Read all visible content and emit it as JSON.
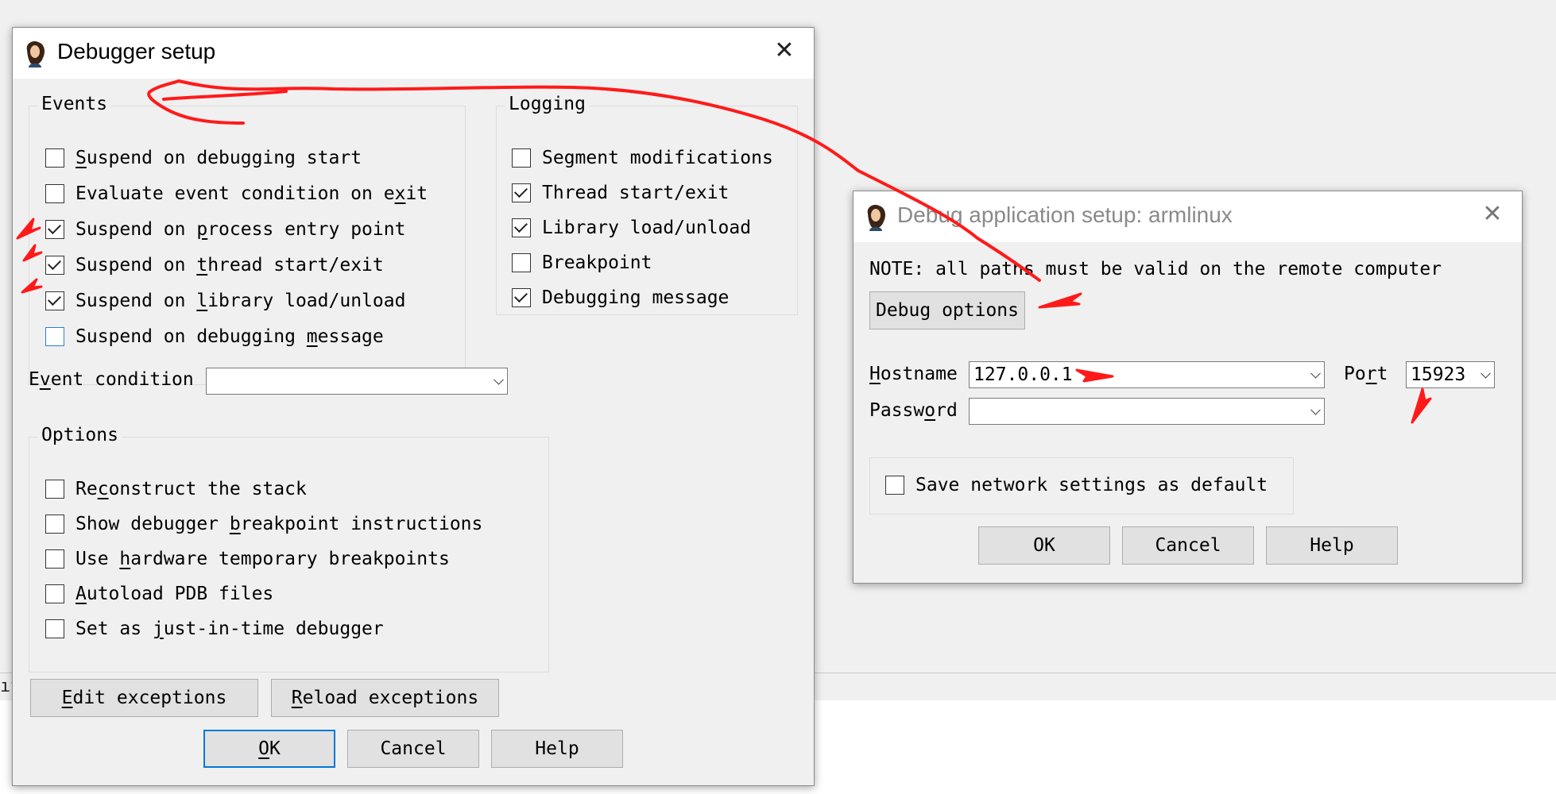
{
  "background": {
    "fragment_text": "ıt"
  },
  "debugger_setup": {
    "title": "Debugger setup",
    "close_glyph": "✕",
    "events": {
      "label": "Events",
      "items": [
        {
          "pre": "",
          "u": "S",
          "post": "uspend on debugging start",
          "checked": false
        },
        {
          "pre": "Evaluate event condition on e",
          "u": "x",
          "post": "it",
          "checked": false
        },
        {
          "pre": "Suspend on ",
          "u": "p",
          "post": "rocess entry point",
          "checked": true
        },
        {
          "pre": "Suspend on ",
          "u": "t",
          "post": "hread start/exit",
          "checked": true
        },
        {
          "pre": "Suspend on ",
          "u": "l",
          "post": "ibrary load/unload",
          "checked": true
        },
        {
          "pre": "Suspend on debugging ",
          "u": "m",
          "post": "essage",
          "checked": false
        }
      ]
    },
    "logging": {
      "label": "Logging",
      "items": [
        {
          "label": "Segment modifications",
          "checked": false
        },
        {
          "label": "Thread start/exit",
          "checked": true
        },
        {
          "label": "Library load/unload",
          "checked": true
        },
        {
          "label": "Breakpoint",
          "checked": false
        },
        {
          "label": "Debugging message",
          "checked": true
        }
      ]
    },
    "event_condition": {
      "pre": "E",
      "u": "v",
      "post": "ent condition",
      "value": ""
    },
    "options": {
      "label": "Options",
      "items": [
        {
          "pre": "Re",
          "u": "c",
          "post": "onstruct the stack",
          "checked": false
        },
        {
          "pre": "Show debugger ",
          "u": "b",
          "post": "reakpoint instructions",
          "checked": false
        },
        {
          "pre": "Use ",
          "u": "h",
          "post": "ardware temporary breakpoints",
          "checked": false
        },
        {
          "pre": "",
          "u": "A",
          "post": "utoload PDB files",
          "checked": false
        },
        {
          "pre": "Set as ",
          "u": "j",
          "post": "ust-in-time debugger",
          "checked": false
        }
      ]
    },
    "edit_exceptions": {
      "pre": "",
      "u": "E",
      "post": "dit exceptions"
    },
    "reload_exceptions": {
      "pre": "",
      "u": "R",
      "post": "eload exceptions"
    },
    "ok": {
      "pre": "",
      "u": "O",
      "post": "K"
    },
    "cancel": "Cancel",
    "help": "Help"
  },
  "debug_app_setup": {
    "title": "Debug application setup: armlinux",
    "close_glyph": "✕",
    "note": "NOTE: all paths must be valid on the remote computer",
    "debug_options": "Debug options",
    "hostname": {
      "pre": "",
      "u": "H",
      "post": "ostname",
      "value": "127.0.0.1"
    },
    "port": {
      "pre": "Po",
      "u": "r",
      "post": "t",
      "value": "15923"
    },
    "password": {
      "pre": "Passw",
      "u": "o",
      "post": "rd",
      "value": ""
    },
    "save_default": {
      "label": "Save network settings as default",
      "checked": false
    },
    "ok": "OK",
    "cancel": "Cancel",
    "help": "Help"
  },
  "annotation_color": "#ff1a1a"
}
